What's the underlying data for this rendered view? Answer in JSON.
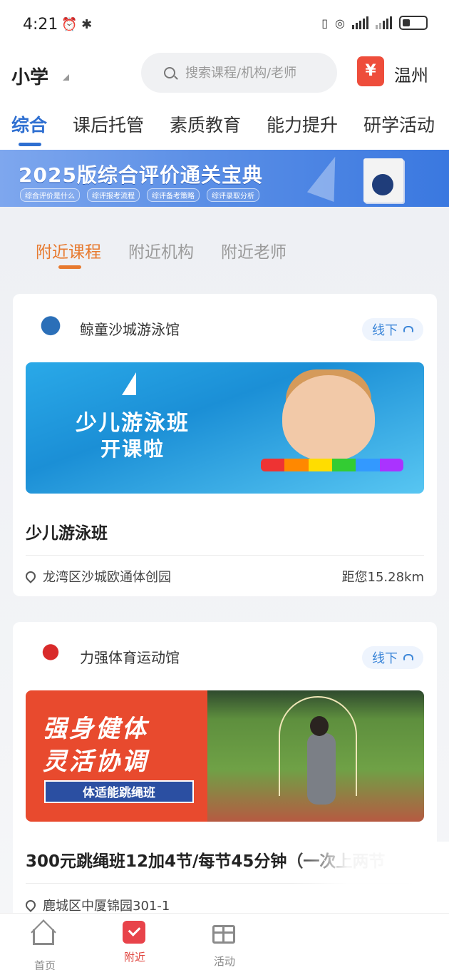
{
  "status_bar": {
    "time": "4:21",
    "icons": [
      "alarm-icon",
      "bluetooth-icon",
      "vibrate-icon",
      "hotspot-icon",
      "signal-icon",
      "signal-icon",
      "battery-icon"
    ]
  },
  "header": {
    "grade": "小学",
    "search_placeholder": "搜索课程/机构/老师",
    "city": "温州",
    "city_icon_glyph": "¥"
  },
  "category_tabs": [
    {
      "label": "综合",
      "active": true
    },
    {
      "label": "课后托管",
      "active": false
    },
    {
      "label": "素质教育",
      "active": false
    },
    {
      "label": "能力提升",
      "active": false
    },
    {
      "label": "研学活动",
      "active": false
    }
  ],
  "banner": {
    "title": "2025版综合评价通关宝典",
    "chips": [
      "综合评价是什么",
      "综评报考流程",
      "综评备考策略",
      "综评录取分析"
    ]
  },
  "nearby_tabs": [
    {
      "label": "附近课程",
      "active": true
    },
    {
      "label": "附近机构",
      "active": false
    },
    {
      "label": "附近老师",
      "active": false
    }
  ],
  "courses": [
    {
      "org_name": "鲸童沙城游泳馆",
      "mode": "线下",
      "image_text": [
        "少儿游泳班",
        "开课啦"
      ],
      "title": "少儿游泳班",
      "address": "龙湾区沙城欧通体创园",
      "distance": "距您15.28km"
    },
    {
      "org_name": "力强体育运动馆",
      "mode": "线下",
      "image_text": [
        "强身健体",
        "灵活协调",
        "体适能跳绳班"
      ],
      "title": "300元跳绳班12加4节/每节45分钟（一次上两节",
      "address": "鹿城区中厦锦园301-1",
      "distance": ""
    }
  ],
  "bottom_nav": [
    {
      "label": "首页",
      "icon": "home-icon",
      "active": false
    },
    {
      "label": "附近",
      "icon": "nearby-check-icon",
      "active": true
    },
    {
      "label": "活动",
      "icon": "gift-icon",
      "active": false
    }
  ],
  "colors": {
    "primary_blue": "#2e6fd1",
    "accent_orange": "#e77a2f",
    "nav_active_red": "#e0443e"
  }
}
